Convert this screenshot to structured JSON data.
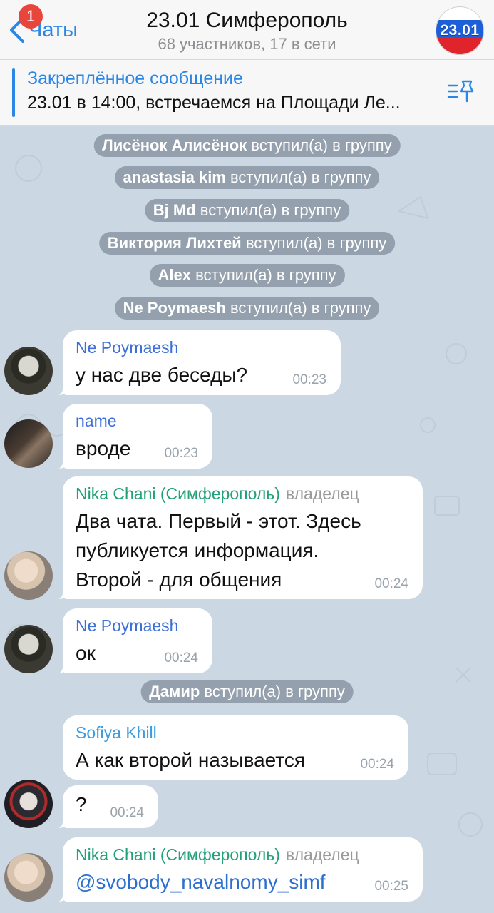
{
  "header": {
    "back_label": "Чаты",
    "unread_count": "1",
    "title": "23.01 Симферополь",
    "subtitle": "68 участников, 17 в сети",
    "avatar_text": "23.01"
  },
  "pinned": {
    "title": "Закреплённое сообщение",
    "text": "23.01 в 14:00, встречаемся на Площади Ле..."
  },
  "service_messages": [
    {
      "name": "Лисёнок Алисёнок",
      "action": "вступил(а) в группу"
    },
    {
      "name": "anastasia kim",
      "action": "вступил(а) в группу"
    },
    {
      "name": "Bj Md",
      "action": "вступил(а) в группу"
    },
    {
      "name": "Виктория Лихтей",
      "action": "вступил(а) в группу"
    },
    {
      "name": "Alex",
      "action": "вступил(а) в группу"
    },
    {
      "name": "Ne Poymaesh",
      "action": "вступил(а) в группу"
    },
    {
      "name": "Дамир",
      "action": "вступил(а) в группу"
    }
  ],
  "messages": [
    {
      "sender": "Ne Poymaesh",
      "sender_color": "#3d6fd8",
      "role": "",
      "text": "у нас две беседы?",
      "time": "00:23"
    },
    {
      "sender": "name",
      "sender_color": "#3d6fd8",
      "role": "",
      "text": "вроде",
      "time": "00:23"
    },
    {
      "sender": "Nika Chani (Симферополь)",
      "sender_color": "#22a07a",
      "role": "владелец",
      "lines": [
        "Два чата. Первый - этот. Здесь",
        "публикуется информация.",
        "Второй - для общения"
      ],
      "time": "00:24"
    },
    {
      "sender": "Ne Poymaesh",
      "sender_color": "#3d6fd8",
      "role": "",
      "text": "ок",
      "time": "00:24"
    },
    {
      "sender": "Sofiya Khill",
      "sender_color": "#3b9ce0",
      "role": "",
      "text": "А как второй называется",
      "time": "00:24"
    },
    {
      "sender": "",
      "text": "?",
      "time": "00:24"
    },
    {
      "sender": "Nika Chani (Симферополь)",
      "sender_color": "#22a07a",
      "role": "владелец",
      "text": "@svobody_navalnomy_simf",
      "time": "00:25"
    }
  ],
  "colors": {
    "accent": "#2b87e6",
    "chat_bg": "#cbd7e2",
    "service_bg": "#84919e"
  }
}
